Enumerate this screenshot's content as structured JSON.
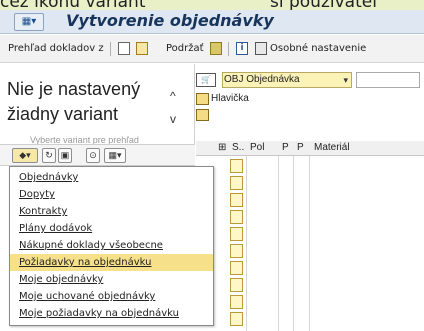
{
  "top_crop": {
    "left_text": "cez ikonu variant",
    "right_text": "si používateľ"
  },
  "title_bar": {
    "title": "Vytvorenie objednávky"
  },
  "toolbar": {
    "overview_label": "Prehľad dokladov z",
    "hold_label": "Podržať",
    "personal_settings_label": "Osobné nastavenie"
  },
  "left_panel": {
    "no_variant_line1": "Nie je nastavený",
    "no_variant_line2": "žiadny variant",
    "hint_partial": "Vyberte variant pre prehľad"
  },
  "document": {
    "type_value": "OBJ Objednávka",
    "header_label": "Hlavička"
  },
  "grid": {
    "headers": [
      "S..",
      "Pol",
      "P",
      "P",
      "Materiál"
    ]
  },
  "menu": {
    "items": [
      "Objednávky",
      "Dopyty",
      "Kontrakty",
      "Plány dodávok",
      "Nákupné doklady všeobecne",
      "Požiadavky na objednávku",
      "Moje objednávky",
      "Moje uchované objednávky",
      "Moje požiadavky na objednávku"
    ],
    "selected_index": 5
  }
}
